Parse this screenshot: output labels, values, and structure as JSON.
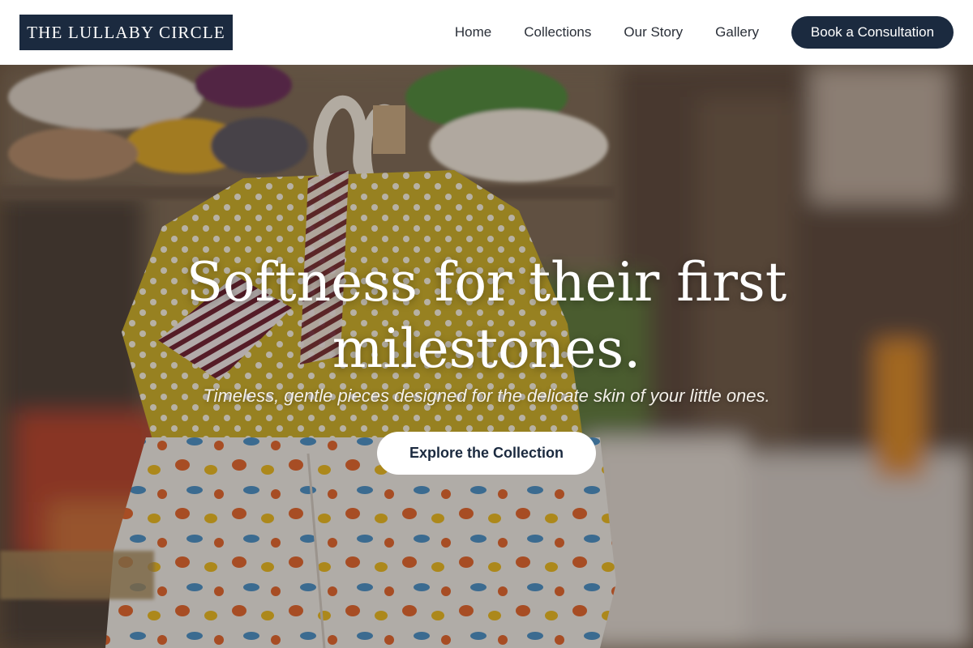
{
  "header": {
    "logo_text": "THE LULLABY CIRCLE",
    "nav": [
      {
        "label": "Home"
      },
      {
        "label": "Collections"
      },
      {
        "label": "Our Story"
      },
      {
        "label": "Gallery"
      }
    ],
    "cta_label": "Book a Consultation"
  },
  "hero": {
    "title_line1": "Softness for their first",
    "title_line2": "milestones.",
    "subtitle": "Timeless, gentle pieces designed for the delicate skin of your little ones.",
    "button_label": "Explore the Collection"
  },
  "colors": {
    "brand_navy": "#1b2a3f",
    "header_bg": "#ffffff",
    "hero_text": "#ffffff"
  }
}
